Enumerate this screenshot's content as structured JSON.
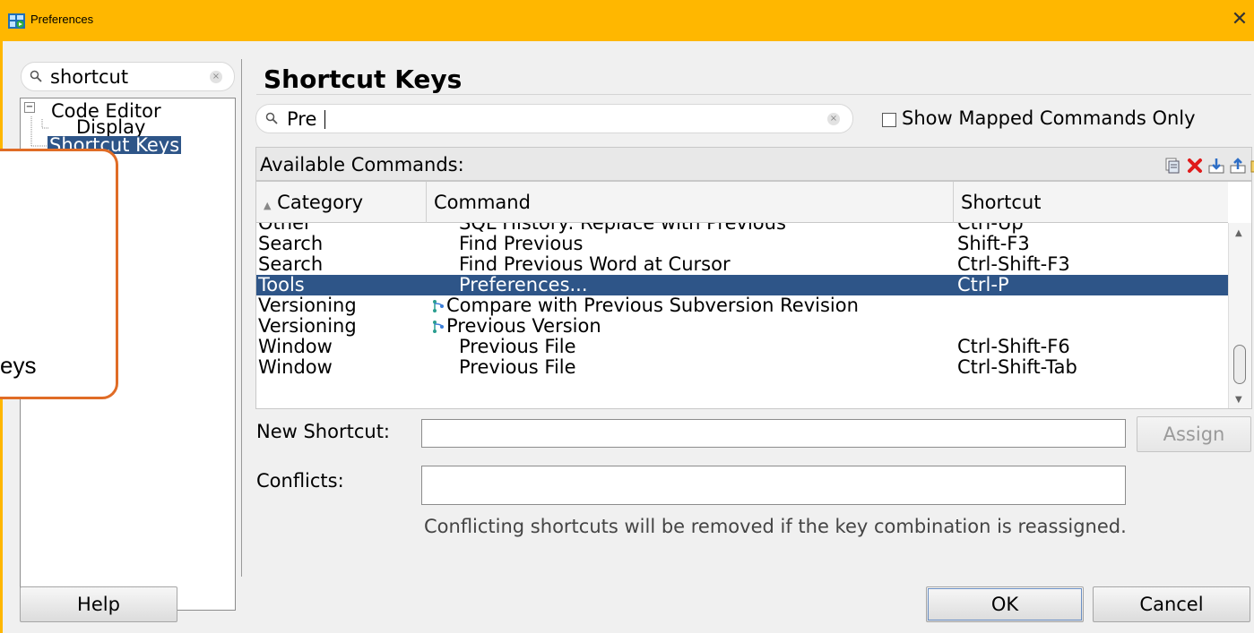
{
  "window": {
    "title": "Preferences",
    "close_glyph": "✕",
    "accent_color": "#ffb700",
    "icon": "preferences-app-icon"
  },
  "left_panel": {
    "search": {
      "value": "shortcut",
      "icon": "search-icon",
      "clear_glyph": "×"
    },
    "tree": {
      "items": [
        {
          "label": "Code Editor",
          "expander": "⊟"
        },
        {
          "label": "Display"
        },
        {
          "label": "Shortcut Keys",
          "selected": true
        }
      ]
    }
  },
  "main": {
    "title": "Shortcut Keys",
    "filter": {
      "value": "Pre",
      "clear_glyph": "×"
    },
    "show_mapped": {
      "label": "Show Mapped Commands Only",
      "checked": false
    },
    "available_commands_label": "Available Commands:",
    "toolbar_icons": [
      "copy-icon",
      "delete-icon",
      "import-icon",
      "export-icon",
      "open-folder-icon"
    ],
    "table": {
      "columns": [
        "Category",
        "Command",
        "Shortcut"
      ],
      "sort_indicator": "▲",
      "rows": [
        {
          "category": "Other",
          "command": "SQL History: Replace with Previous",
          "shortcut": "Ctrl-Up"
        },
        {
          "category": "Search",
          "command": "Find Previous",
          "shortcut": "Shift-F3"
        },
        {
          "category": "Search",
          "command": "Find Previous Word at Cursor",
          "shortcut": "Ctrl-Shift-F3"
        },
        {
          "category": "Tools",
          "command": "Preferences...",
          "shortcut": "Ctrl-P",
          "selected": true
        },
        {
          "category": "Versioning",
          "command": "Compare with Previous Subversion Revision",
          "shortcut": "",
          "icon": "version-icon"
        },
        {
          "category": "Versioning",
          "command": "Previous Version",
          "shortcut": "",
          "icon": "version-icon"
        },
        {
          "category": "Window",
          "command": "Previous File",
          "shortcut": "Ctrl-Shift-F6"
        },
        {
          "category": "Window",
          "command": "Previous File",
          "shortcut": "Ctrl-Shift-Tab"
        }
      ],
      "scroll_up": "▲",
      "scroll_down": "▼"
    },
    "new_shortcut": {
      "label": "New Shortcut:",
      "value": ""
    },
    "conflicts": {
      "label": "Conflicts:",
      "value": "",
      "note": "Conflicting shortcuts will be removed if the key combination is reassigned."
    },
    "assign_button": "Assign"
  },
  "footer": {
    "help_button": "Help",
    "ok_button": "OK",
    "cancel_button": "Cancel"
  },
  "annotation": {
    "text": "eys",
    "border_color": "#e06c26"
  }
}
